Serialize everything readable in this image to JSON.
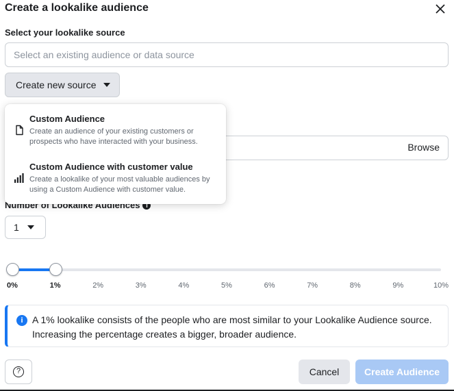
{
  "dialog": {
    "title": "Create a lookalike audience"
  },
  "source": {
    "label": "Select your lookalike source",
    "placeholder": "Select an existing audience or data source",
    "create_new_label": "Create new source"
  },
  "dropdown": {
    "items": [
      {
        "title": "Custom Audience",
        "description": "Create an audience of your existing customers or prospects who have interacted with your business.",
        "icon": "document-icon"
      },
      {
        "title": "Custom Audience with customer value",
        "description": "Create a lookalike of your most valuable audiences by using a Custom Audience with customer value.",
        "icon": "bar-chart-icon"
      }
    ]
  },
  "location": {
    "browse_label": "Browse"
  },
  "number": {
    "label": "Number of Lookalike Audiences",
    "info_glyph": "i",
    "selected": "1"
  },
  "slider": {
    "ticks": [
      "0%",
      "1%",
      "2%",
      "3%",
      "4%",
      "5%",
      "6%",
      "7%",
      "8%",
      "9%",
      "10%"
    ],
    "range_start_percent": 0,
    "range_end_percent": 1,
    "accent": "#1877f2"
  },
  "info": {
    "glyph": "i",
    "text": "A 1% lookalike consists of the people who are most similar to your Lookalike Audience source. Increasing the percentage creates a bigger, broader audience."
  },
  "footer": {
    "help_glyph": "?",
    "cancel_label": "Cancel",
    "create_label": "Create Audience"
  }
}
